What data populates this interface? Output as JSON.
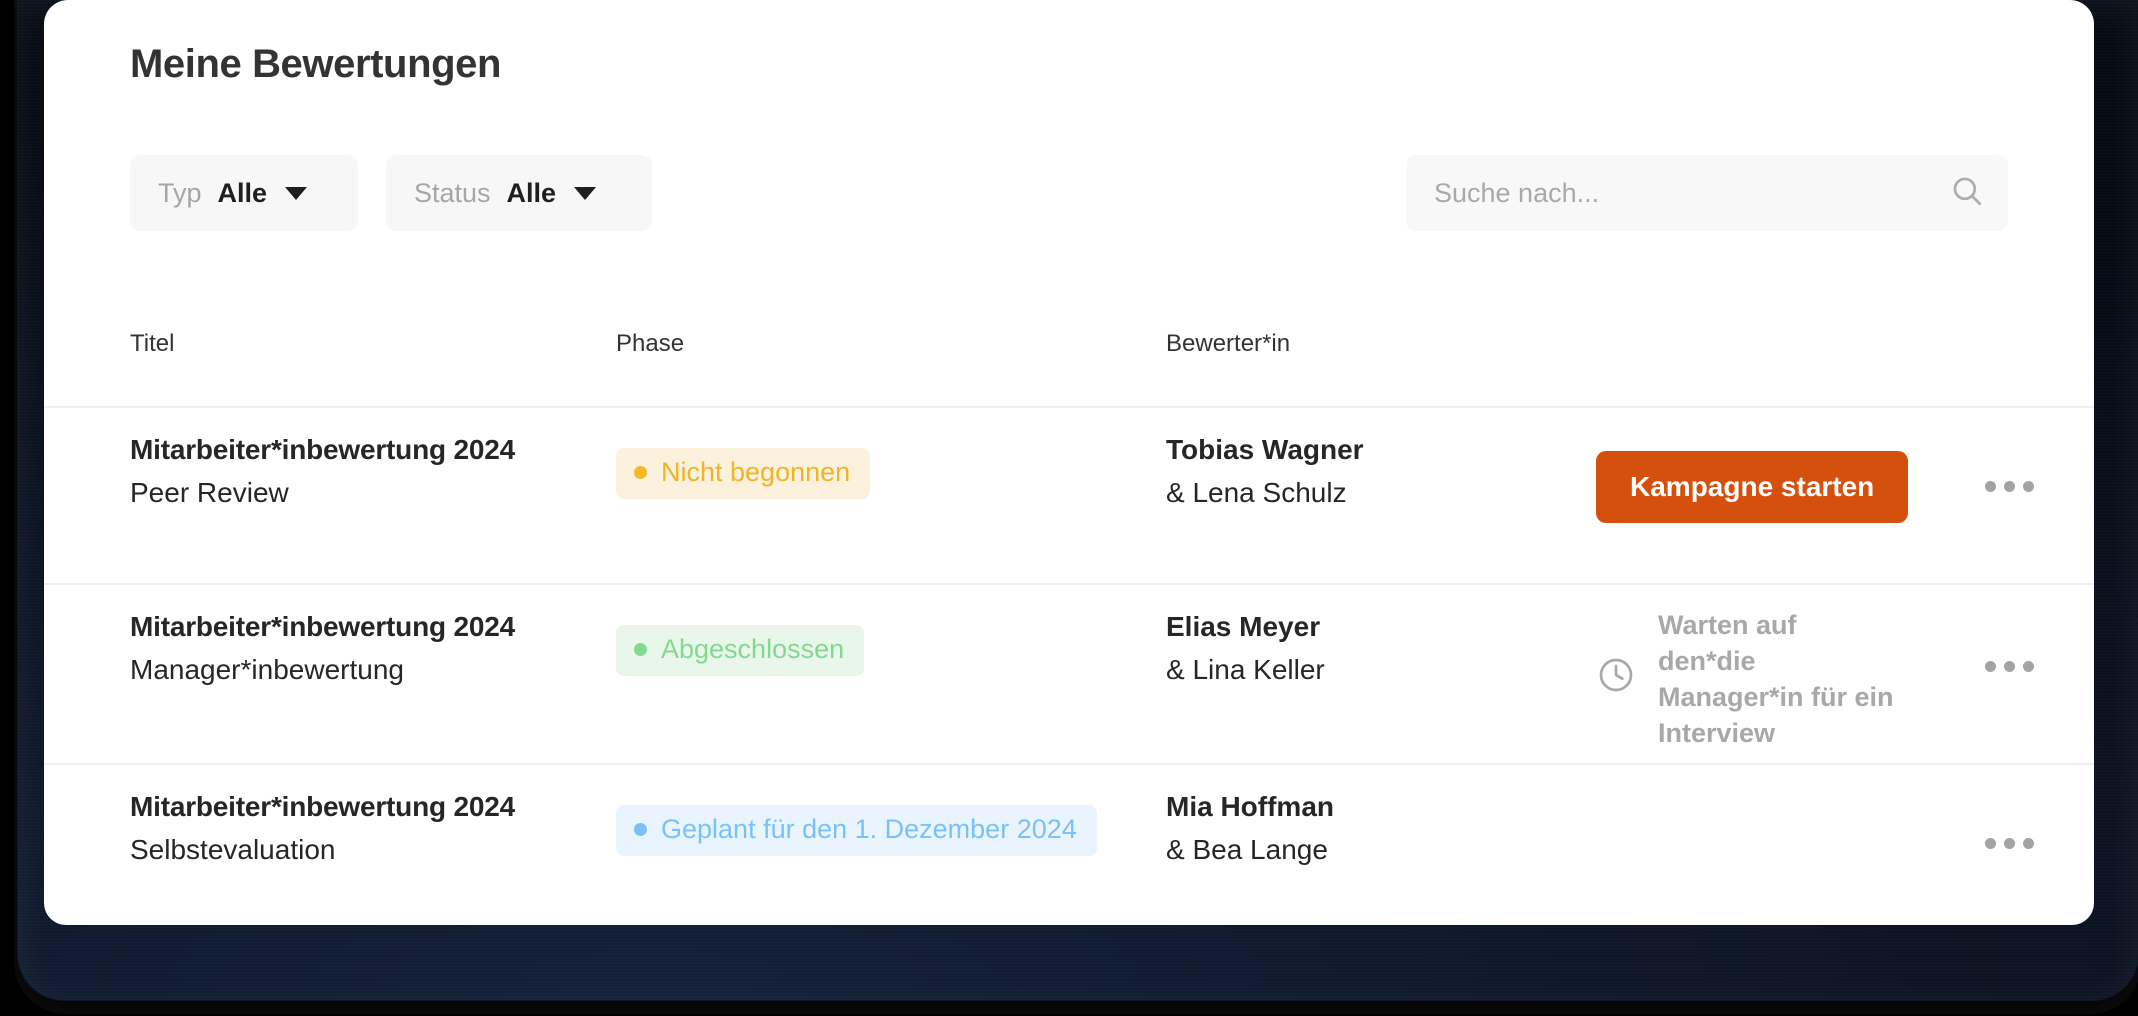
{
  "page": {
    "title": "Meine Bewertungen"
  },
  "toolbar": {
    "filters": [
      {
        "label": "Typ",
        "value": "Alle",
        "icon": "chevron-down-icon"
      },
      {
        "label": "Status",
        "value": "Alle",
        "icon": "chevron-down-icon"
      }
    ],
    "search": {
      "placeholder": "Suche nach...",
      "value": "",
      "icon": "search-icon"
    }
  },
  "table": {
    "columns": [
      "Titel",
      "Phase",
      "Bewerter*in"
    ],
    "rows": [
      {
        "title": "Mitarbeiter*inbewertung 2024",
        "subtitle": "Peer Review",
        "phase": {
          "text": "Nicht begonnen",
          "style": "amber"
        },
        "reviewer_primary": "Tobias Wagner",
        "reviewer_secondary": "& Lena Schulz",
        "action": {
          "type": "button",
          "label": "Kampagne starten"
        },
        "menu": "more-options"
      },
      {
        "title": "Mitarbeiter*inbewertung 2024",
        "subtitle": "Manager*inbewertung",
        "phase": {
          "text": "Abgeschlossen",
          "style": "green"
        },
        "reviewer_primary": "Elias Meyer",
        "reviewer_secondary": "& Lina Keller",
        "action": {
          "type": "status",
          "label": "Warten auf den*die Manager*in für ein Interview",
          "icon": "clock-icon"
        },
        "menu": "more-options"
      },
      {
        "title": "Mitarbeiter*inbewertung 2024",
        "subtitle": "Selbstevaluation",
        "phase": {
          "text": "Geplant für den 1. Dezember 2024",
          "style": "blue"
        },
        "reviewer_primary": "Mia Hoffman",
        "reviewer_secondary": "& Bea Lange",
        "action": {
          "type": "none",
          "label": ""
        },
        "menu": "more-options"
      }
    ]
  },
  "colors": {
    "accent": "#d4500c",
    "badge_amber_text": "#f0b429",
    "badge_amber_bg": "#fbf1dd",
    "badge_green_text": "#84d991",
    "badge_green_bg": "#e8f7e9",
    "badge_blue_text": "#79c2f7",
    "badge_blue_bg": "#e9f4fe",
    "muted_text": "#a8a8a8",
    "bezel": "#0d1526"
  }
}
